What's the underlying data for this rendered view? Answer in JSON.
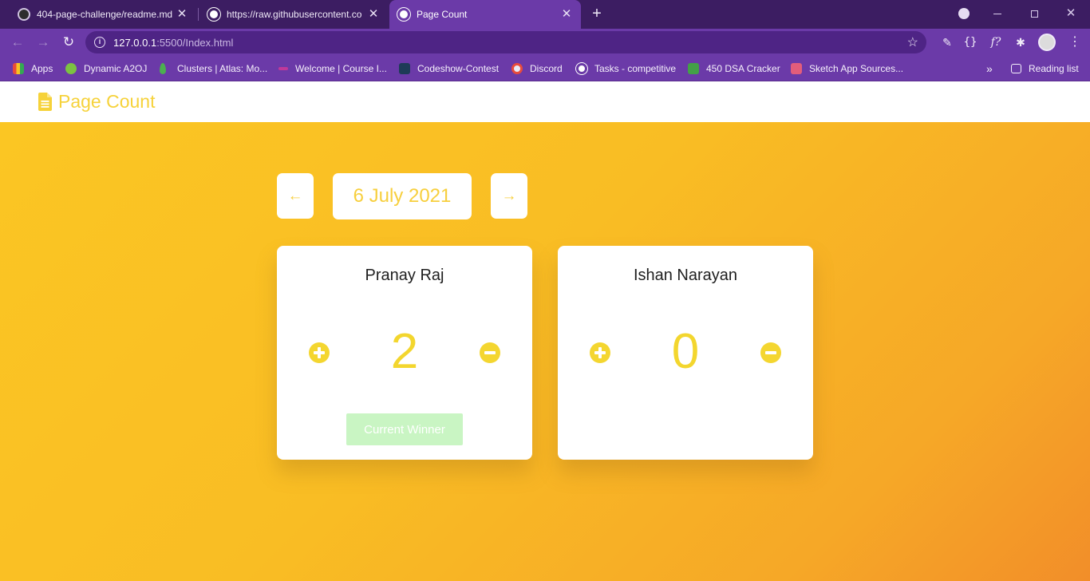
{
  "browser": {
    "tabs": [
      {
        "title": "404-page-challenge/readme.md",
        "active": false,
        "icon": "github-icon"
      },
      {
        "title": "https://raw.githubusercontent.co",
        "active": false,
        "icon": "globe-icon"
      },
      {
        "title": "Page Count",
        "active": true,
        "icon": "globe-icon"
      }
    ],
    "tab_close_glyph": "✕",
    "new_tab_glyph": "+",
    "url": {
      "host": "127.0.0.1",
      "rest": ":5500/Index.html"
    },
    "bookmarks": [
      {
        "label": "Apps",
        "icon": "apps-grid-icon",
        "color": "#e84b3c"
      },
      {
        "label": "Dynamic A2OJ",
        "icon": "a2oj-icon",
        "color": "#7cc242"
      },
      {
        "label": "Clusters | Atlas: Mo...",
        "icon": "mongodb-leaf-icon",
        "color": "#4caf50"
      },
      {
        "label": "Welcome | Course I...",
        "icon": "course-icon",
        "color": "#c0399a"
      },
      {
        "label": "Codeshow-Contest",
        "icon": "codeshow-icon",
        "color": "#1d3b57"
      },
      {
        "label": "Discord",
        "icon": "discord-icon",
        "color": "#e8eaf6"
      },
      {
        "label": "Tasks - competitive",
        "icon": "globe-icon",
        "color": "#ffffff"
      },
      {
        "label": "450 DSA Cracker",
        "icon": "dsa-icon",
        "color": "#43a047"
      },
      {
        "label": "Sketch App Sources...",
        "icon": "sketch-icon",
        "color": "#e35d7b"
      }
    ],
    "bookmarks_overflow": "»",
    "reading_list": "Reading list"
  },
  "app": {
    "title": "Page Count",
    "brand_color": "#f6d23a",
    "date": "6 July 2021",
    "prev_icon": "arrow-left-icon",
    "next_icon": "arrow-right-icon",
    "players": [
      {
        "name": "Pranay Raj",
        "score": "2",
        "winner_label": "Current Winner"
      },
      {
        "name": "Ishan Narayan",
        "score": "0"
      }
    ]
  }
}
